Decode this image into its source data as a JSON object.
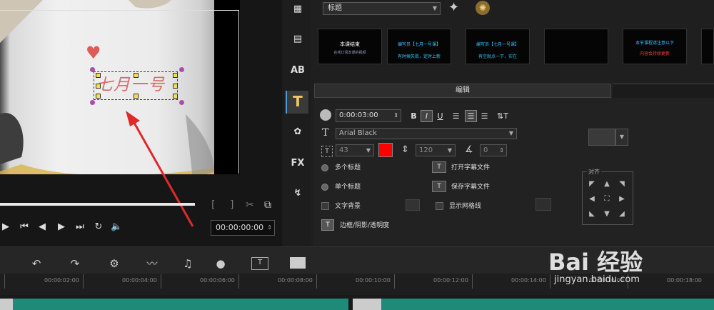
{
  "library": {
    "category": "标题",
    "thumbnails": [
      {
        "line1": "本课结束",
        "line2": "在线订阅本课的视频",
        "color1": "#ffffff",
        "color2": "#8fa0c0"
      },
      {
        "line1": "编写员【七月一号课】",
        "line2": "有时候失败，定时上新",
        "color1": "#33c6ff",
        "color2": "#33c6ff"
      },
      {
        "line1": "编写员【七月一号课】",
        "line2": "有空就点一下，实在",
        "color1": "#33c6ff",
        "color2": "#33c6ff"
      },
      {
        "line1": "",
        "line2": "",
        "color1": "#ffffff",
        "color2": "#ffffff"
      },
      {
        "line1": "本节课程请注意以下",
        "line2": "内容会持续更新",
        "color1": "#33c6ff",
        "color2": "#ff3a3a"
      },
      {
        "line1": "",
        "line2": "",
        "color1": "#ffffff",
        "color2": "#ffffff"
      }
    ]
  },
  "preview": {
    "title_text": "七月一号",
    "timecode": "00:00:00:00"
  },
  "editor": {
    "tab_label": "编辑",
    "duration": "0:00:03:00",
    "font": "Arial Black",
    "font_size": "43",
    "line_spacing": "120",
    "angle": "0",
    "text_color": "#ff0000",
    "multi_title": "多个标题",
    "single_title": "单个标题",
    "open_subtitle": "打开字幕文件",
    "save_subtitle": "保存字幕文件",
    "text_background": "文字背景",
    "show_grid": "显示网格线",
    "border_shadow": "边框/阴影/透明度",
    "align_label": "对齐"
  },
  "timeline": {
    "ticks": [
      "00:00:02:00",
      "00:00:04:00",
      "00:00:06:00",
      "00:00:08:00",
      "00:00:10:00",
      "00:00:12:00",
      "00:00:14:00",
      "00:00:16:00",
      "00:00:18:00"
    ]
  },
  "watermark": {
    "logo": "Bai 经验",
    "url": "jingyan.baidu.com"
  }
}
